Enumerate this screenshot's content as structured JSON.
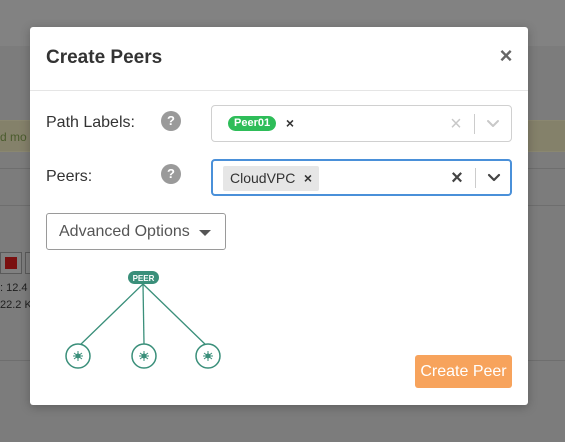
{
  "background": {
    "banner_text": "d mo",
    "stat_line_1": ": 12.4",
    "stat_line_2": "22.2 K"
  },
  "modal": {
    "title": "Create Peers",
    "close_glyph": "×"
  },
  "form": {
    "path_labels": {
      "label": "Path Labels:",
      "help": "?",
      "selected": [
        {
          "text": "Peer01",
          "color": "#2ebd59"
        }
      ],
      "remove_glyph": "×",
      "clear_glyph": "×"
    },
    "peers": {
      "label": "Peers:",
      "help": "?",
      "selected": [
        "CloudVPC"
      ],
      "remove_glyph": "×",
      "clear_glyph": "×"
    }
  },
  "advanced_options": {
    "label": "Advanced Options"
  },
  "diagram": {
    "peer_label": "PEER",
    "node_count": 3,
    "color": "#3a8f7a"
  },
  "actions": {
    "create_peer": "Create Peer",
    "create_color": "#f7a35c"
  },
  "colors": {
    "focus_border": "#4a90d9",
    "chip_gray": "#e6e6e6"
  }
}
